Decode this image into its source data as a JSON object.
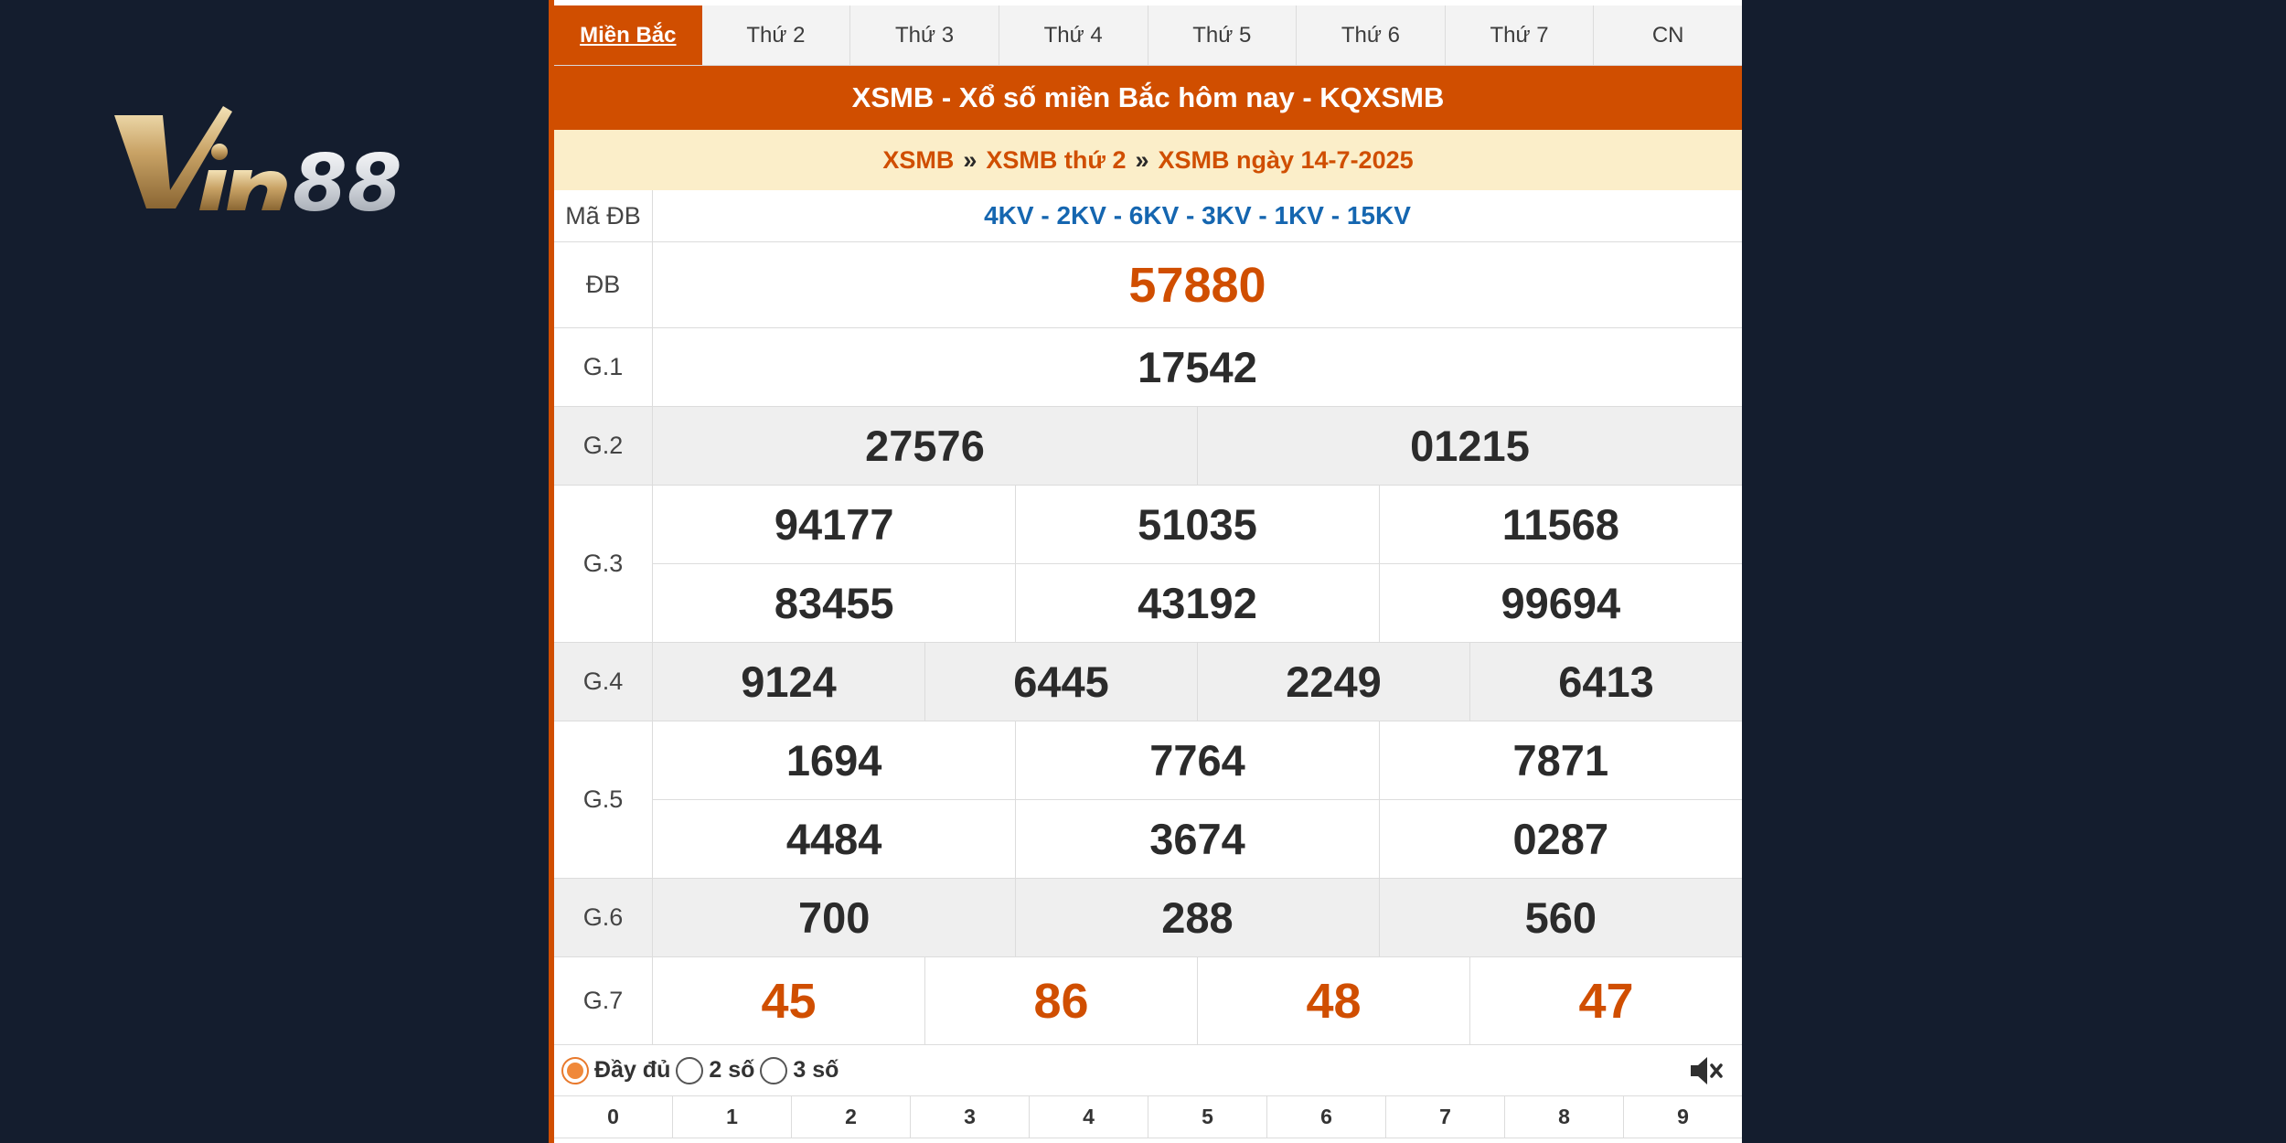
{
  "logo": {
    "text": "Vin88"
  },
  "tabs": [
    "Miền Bắc",
    "Thứ 2",
    "Thứ 3",
    "Thứ 4",
    "Thứ 5",
    "Thứ 6",
    "Thứ 7",
    "CN"
  ],
  "active_tab": 0,
  "title": "XSMB - Xổ số miền Bắc hôm nay - KQXSMB",
  "breadcrumb": {
    "item1": "XSMB",
    "sep": "»",
    "item2": "XSMB thứ 2",
    "item3": "XSMB ngày 14-7-2025"
  },
  "results": {
    "code": {
      "label": "Mã ĐB",
      "value": "4KV - 2KV - 6KV - 3KV - 1KV - 15KV"
    },
    "db": {
      "label": "ĐB",
      "values": [
        "57880"
      ]
    },
    "g1": {
      "label": "G.1",
      "values": [
        "17542"
      ]
    },
    "g2": {
      "label": "G.2",
      "values": [
        "27576",
        "01215"
      ]
    },
    "g3": {
      "label": "G.3",
      "values": [
        "94177",
        "51035",
        "11568",
        "83455",
        "43192",
        "99694"
      ]
    },
    "g4": {
      "label": "G.4",
      "values": [
        "9124",
        "6445",
        "2249",
        "6413"
      ]
    },
    "g5": {
      "label": "G.5",
      "values": [
        "1694",
        "7764",
        "7871",
        "4484",
        "3674",
        "0287"
      ]
    },
    "g6": {
      "label": "G.6",
      "values": [
        "700",
        "288",
        "560"
      ]
    },
    "g7": {
      "label": "G.7",
      "values": [
        "45",
        "86",
        "48",
        "47"
      ]
    }
  },
  "options": [
    "Đầy đủ",
    "2 số",
    "3 số"
  ],
  "selected_option": 0,
  "mute_icon": "speaker-muted-icon",
  "digits": [
    "0",
    "1",
    "2",
    "3",
    "4",
    "5",
    "6",
    "7",
    "8",
    "9"
  ],
  "colors": {
    "accent": "#d04e00",
    "breadcrumb_bg": "#fbeec9",
    "code_blue": "#1566b0",
    "background": "#141d2e"
  }
}
